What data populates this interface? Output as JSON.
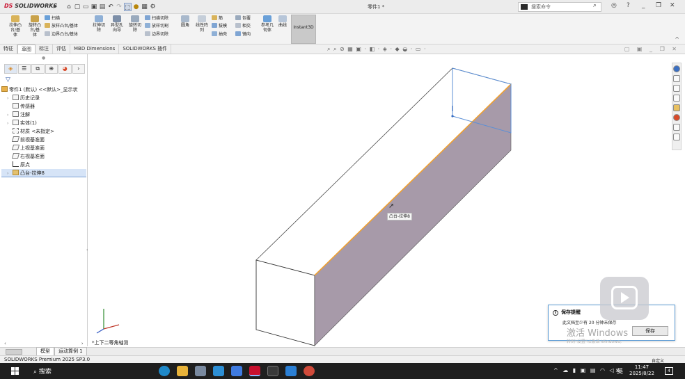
{
  "titlebar": {
    "logo_ds": "DS",
    "logo_text": "SOLIDWORKS",
    "doc_title": "零件1 *",
    "search_placeholder": "搜索命令",
    "search_arrow": "Q",
    "min": "_",
    "restore": "❐",
    "close": "✕"
  },
  "ribbon": {
    "extrude_boss": "拉伸凸\n台/基\n体",
    "revolve_boss": "旋转凸\n台/基\n体",
    "sweep": "扫描",
    "loft": "放样凸台/基体",
    "boundary": "边界凸台/基体",
    "extrude_cut": "拉伸切\n除",
    "hole_wizard": "异型孔\n向导",
    "revolve_cut": "旋转切\n除",
    "swept_cut": "扫描切除",
    "lofted_cut": "放样切割",
    "boundary_cut": "边界切除",
    "fillet": "圆角",
    "linear_pattern": "线性阵\n列",
    "rib": "筋",
    "draft": "拔模",
    "shell": "抽壳",
    "wrap": "包覆",
    "intersect": "相交",
    "mirror": "镜向",
    "ref_geometry": "参考几\n何体",
    "curves": "曲线",
    "instant3d": "Instant3D"
  },
  "tabs": [
    "特征",
    "草图",
    "标注",
    "评估",
    "MBD Dimensions",
    "SOLIDWORKS 插件"
  ],
  "tree": {
    "root": "零件1 (默认) <<默认>_显示状",
    "items": [
      {
        "label": "历史记录",
        "twisty": "›"
      },
      {
        "label": "传感器",
        "twisty": ""
      },
      {
        "label": "注解",
        "twisty": "›"
      },
      {
        "label": "实体(1)",
        "twisty": "›"
      },
      {
        "label": "材质 <未指定>",
        "twisty": ""
      },
      {
        "label": "前视基准面",
        "twisty": ""
      },
      {
        "label": "上视基准面",
        "twisty": ""
      },
      {
        "label": "右视基准面",
        "twisty": ""
      },
      {
        "label": "原点",
        "twisty": ""
      },
      {
        "label": "凸台-拉伸8",
        "twisty": "›"
      }
    ]
  },
  "viewport": {
    "tooltip": "凸台-拉伸8",
    "view_name": "*上下二等角轴测"
  },
  "modeltabs": [
    "模型",
    "运动算例 1"
  ],
  "status": {
    "version": "SOLIDWORKS Premium 2025 SP3.0",
    "custom": "自定义"
  },
  "toast": {
    "title": "保存提醒",
    "message": "此文档至少有 20 分钟未保存",
    "save_button": "保存"
  },
  "watermark": {
    "line1": "激活 Windows",
    "line2": "转到\"设置\"以激活 Windows。"
  },
  "taskbar": {
    "search": "搜索",
    "ime": "英",
    "time": "11:47",
    "date": "2025/8/22",
    "notifications": "4"
  }
}
